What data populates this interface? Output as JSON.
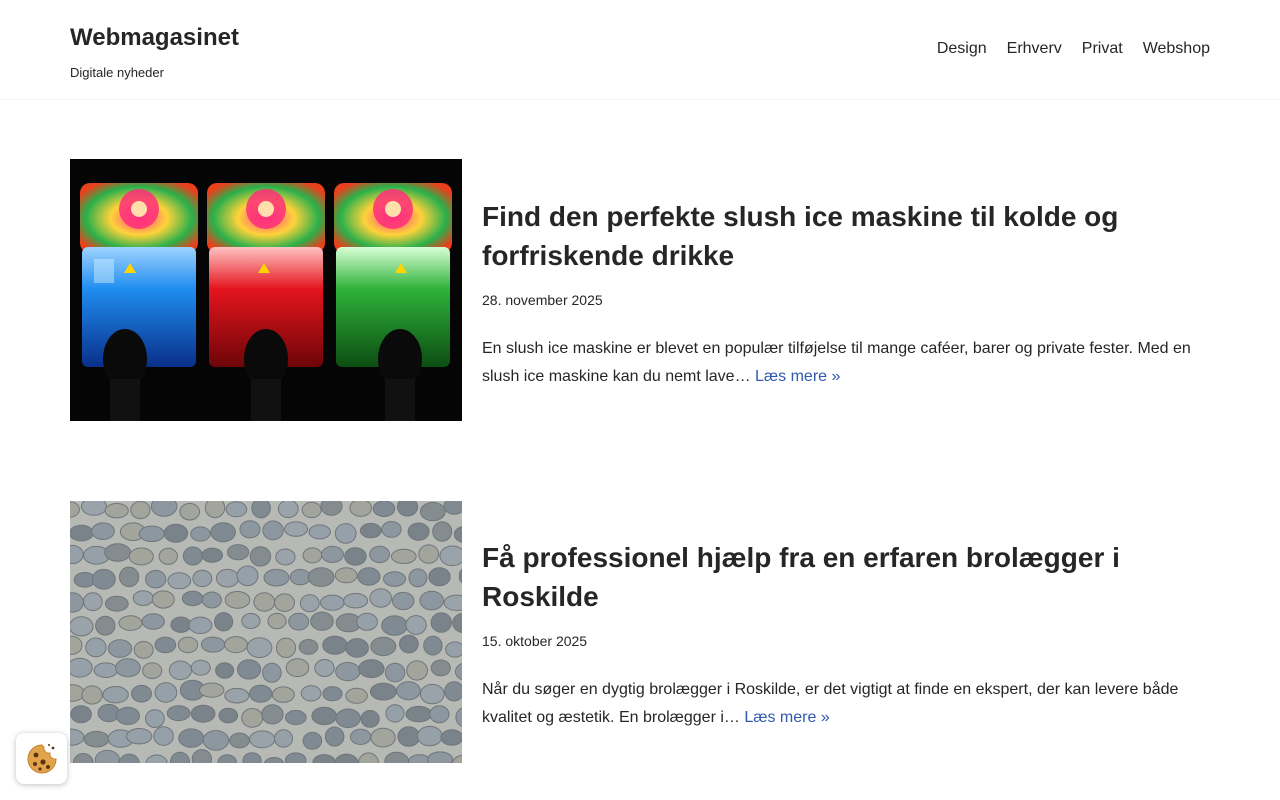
{
  "header": {
    "site_title": "Webmagasinet",
    "tagline": "Digitale nyheder",
    "nav": [
      "Design",
      "Erhverv",
      "Privat",
      "Webshop"
    ]
  },
  "posts": [
    {
      "title": "Find den perfekte slush ice maskine til kolde og forfriskende drikke",
      "date": "28. november 2025",
      "excerpt": "En slush ice maskine er blevet en populær tilføjelse til mange caféer, barer og private fester. Med en slush ice maskine kan du nemt lave…",
      "read_more": "Læs mere »"
    },
    {
      "title": "Få professionel hjælp fra en erfaren brolægger i Roskilde",
      "date": "15. oktober 2025",
      "excerpt": "Når du søger en dygtig brolægger i Roskilde, er det vigtigt at finde en ekspert, der kan levere både kvalitet og æstetik. En brolægger i…",
      "read_more": "Læs mere »"
    }
  ],
  "colors": {
    "text": "#272626",
    "link": "#2f5aae",
    "slush_blue": "#1e73e8",
    "slush_red": "#d8121c",
    "slush_green": "#1f9e2c",
    "cobble": "#8a949c"
  },
  "icons": {
    "cookie": "cookie-icon"
  }
}
